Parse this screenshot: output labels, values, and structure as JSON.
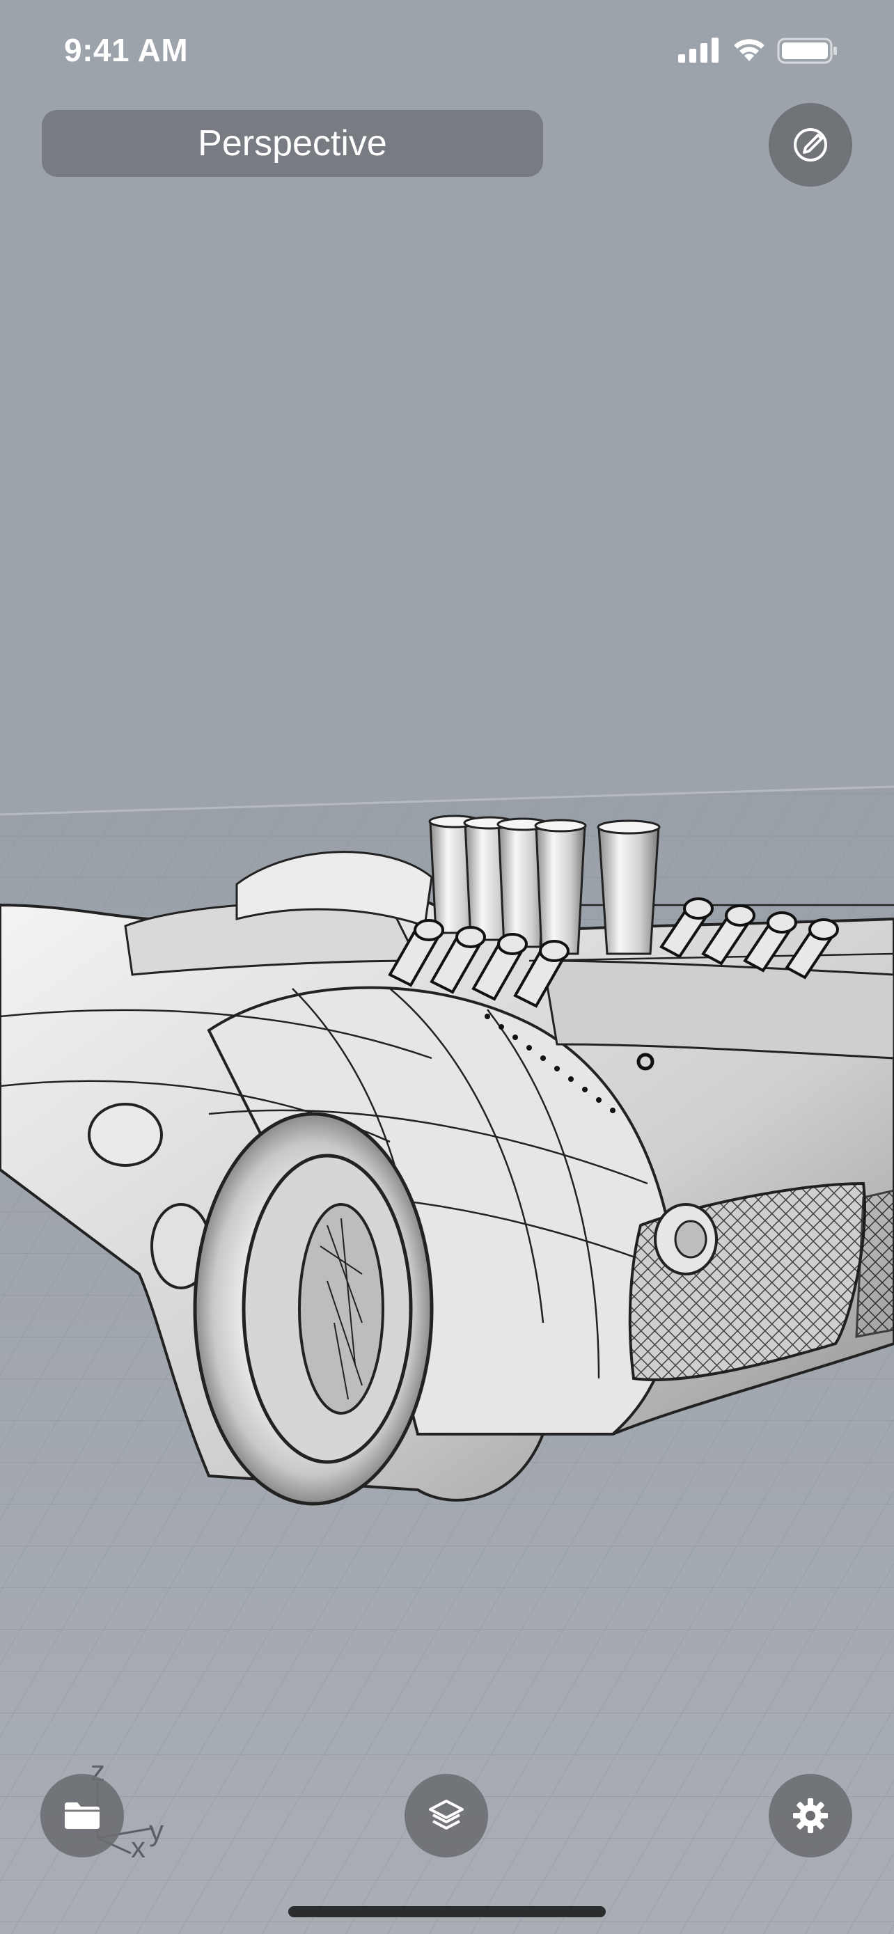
{
  "status_bar": {
    "time": "9:41 AM",
    "icons": [
      "cellular-signal-icon",
      "wifi-icon",
      "battery-icon"
    ]
  },
  "viewport": {
    "title": "Perspective",
    "background_color": "#9da3ab",
    "axes": {
      "z": "z",
      "x": "x",
      "y": "y"
    }
  },
  "toolbar": {
    "top_right_icon": "pen-edit-icon",
    "bottom_left_icon": "folder-icon",
    "bottom_center_icon": "layers-icon",
    "bottom_right_icon": "gear-icon"
  }
}
